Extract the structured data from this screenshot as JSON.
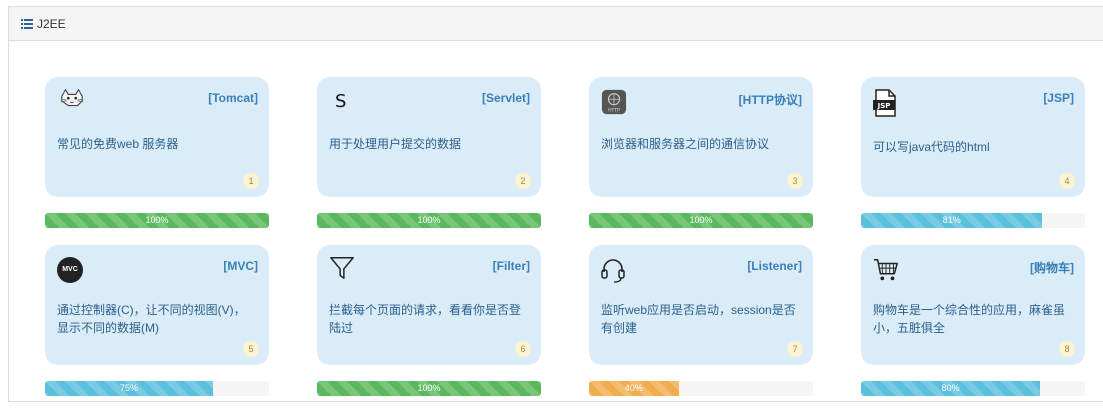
{
  "panel": {
    "title": "J2EE",
    "icon": "list-icon"
  },
  "cards": [
    {
      "tag": "[Tomcat]",
      "desc": "常见的免费web 服务器",
      "num": "1",
      "icon": "tomcat-cat-icon",
      "progress_label": "100%",
      "progress": 100,
      "bar_style": "success"
    },
    {
      "tag": "[Servlet]",
      "desc": "用于处理用户提交的数据",
      "num": "2",
      "icon": "letter-s-icon",
      "icon_text": "S",
      "progress_label": "100%",
      "progress": 100,
      "bar_style": "success"
    },
    {
      "tag": "[HTTP协议]",
      "desc": "浏览器和服务器之间的通信协议",
      "num": "3",
      "icon": "http-globe-icon",
      "icon_text": "HTTP",
      "progress_label": "100%",
      "progress": 100,
      "bar_style": "success"
    },
    {
      "tag": "[JSP]",
      "desc": "可以写java代码的html",
      "num": "4",
      "icon": "jsp-file-icon",
      "icon_text": "JSP",
      "progress_label": "81%",
      "progress": 81,
      "bar_style": "info"
    },
    {
      "tag": "[MVC]",
      "desc": "通过控制器(C)，让不同的视图(V)，显示不同的数据(M)",
      "num": "5",
      "icon": "mvc-badge-icon",
      "icon_text": "MVC",
      "progress_label": "75%",
      "progress": 75,
      "bar_style": "info"
    },
    {
      "tag": "[Filter]",
      "desc": "拦截每个页面的请求，看看你是否登陆过",
      "num": "6",
      "icon": "funnel-filter-icon",
      "progress_label": "100%",
      "progress": 100,
      "bar_style": "success"
    },
    {
      "tag": "[Listener]",
      "desc": "监听web应用是否启动，session是否有创建",
      "num": "7",
      "icon": "headset-icon",
      "progress_label": "40%",
      "progress": 40,
      "bar_style": "warning"
    },
    {
      "tag": "[购物车]",
      "desc": "购物车是一个综合性的应用，麻雀虽小，五脏俱全",
      "num": "8",
      "icon": "shopping-cart-icon",
      "progress_label": "80%",
      "progress": 80,
      "bar_style": "info"
    }
  ],
  "colors": {
    "card_bg": "#d9ecf7",
    "tag": "#3a7fb8",
    "success": "#5cb85c",
    "info": "#5bc0de",
    "warning": "#f0ad4e"
  }
}
